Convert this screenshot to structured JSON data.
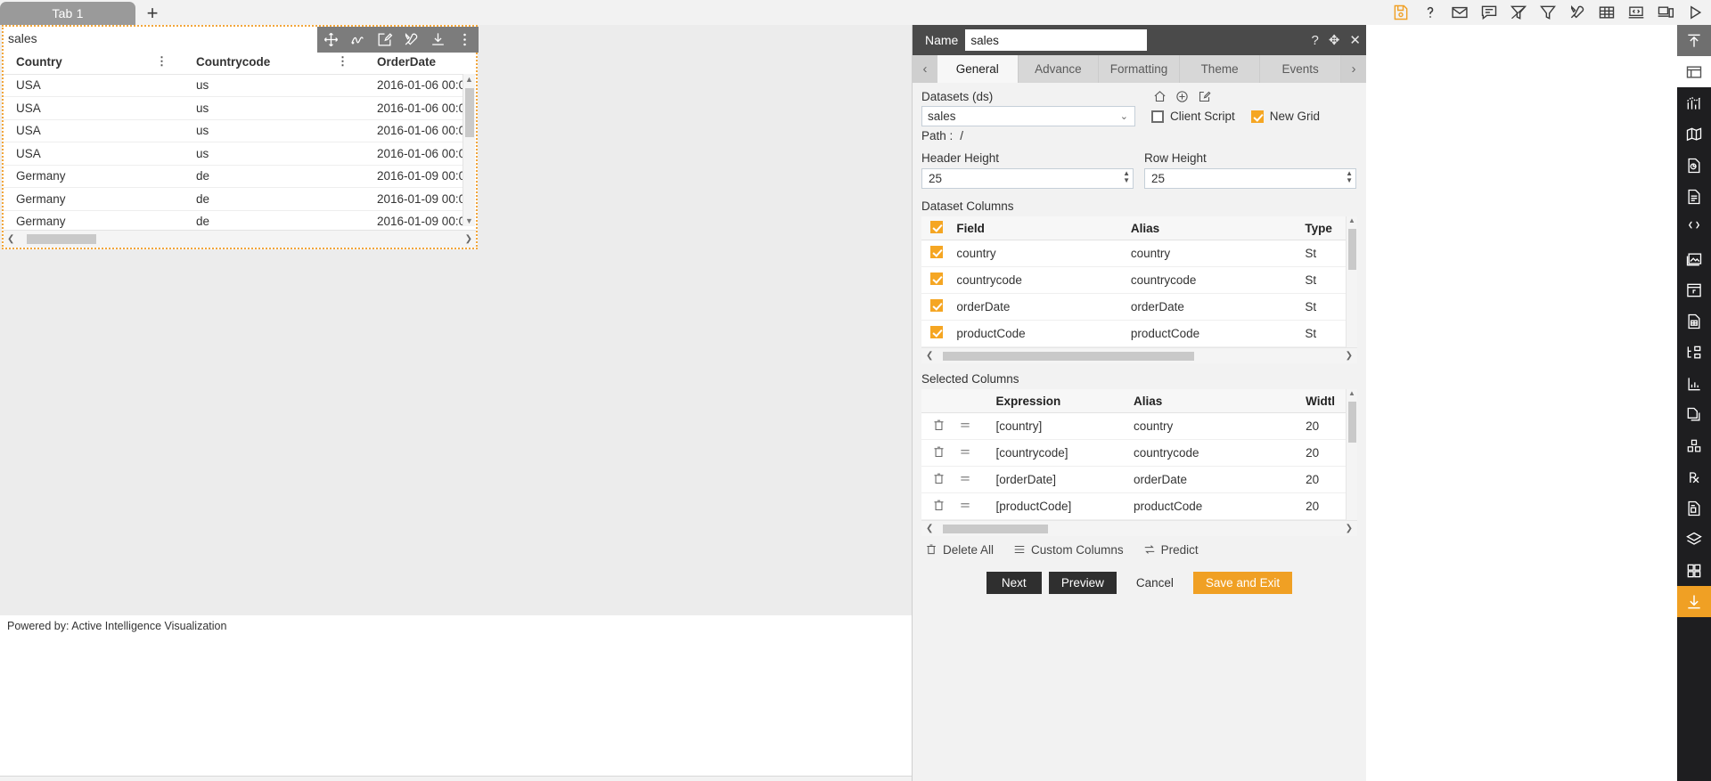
{
  "window": {
    "tabs": [
      {
        "label": "Tab 1"
      }
    ],
    "add_tab_label": "+",
    "system_toolbar": [
      {
        "name": "save-icon",
        "title": "Save"
      },
      {
        "name": "help-icon",
        "title": "Help"
      },
      {
        "name": "mail-icon",
        "title": "Mail"
      },
      {
        "name": "comment-icon",
        "title": "Comment"
      },
      {
        "name": "clear-filter-icon",
        "title": "Clear Filter"
      },
      {
        "name": "filter-icon",
        "title": "Filter"
      },
      {
        "name": "tools-icon",
        "title": "Tools"
      },
      {
        "name": "table-icon",
        "title": "Table"
      },
      {
        "name": "code-icon",
        "title": "Code"
      },
      {
        "name": "devices-icon",
        "title": "Devices"
      },
      {
        "name": "run-icon",
        "title": "Run"
      }
    ]
  },
  "widget": {
    "title": "sales",
    "toolbar": [
      {
        "name": "move-icon",
        "title": "Move"
      },
      {
        "name": "scribble-icon",
        "title": "Scribble"
      },
      {
        "name": "edit-icon",
        "title": "Edit"
      },
      {
        "name": "tools-icon",
        "title": "Tools"
      },
      {
        "name": "download-icon",
        "title": "Download"
      },
      {
        "name": "more-icon",
        "title": "More"
      }
    ],
    "columns": [
      "Country",
      "Countrycode",
      "OrderDate"
    ],
    "rows": [
      [
        "USA",
        "us",
        "2016-01-06 00:0"
      ],
      [
        "USA",
        "us",
        "2016-01-06 00:0"
      ],
      [
        "USA",
        "us",
        "2016-01-06 00:0"
      ],
      [
        "USA",
        "us",
        "2016-01-06 00:0"
      ],
      [
        "Germany",
        "de",
        "2016-01-09 00:0"
      ],
      [
        "Germany",
        "de",
        "2016-01-09 00:0"
      ],
      [
        "Germany",
        "de",
        "2016-01-09 00:0"
      ]
    ]
  },
  "footer": {
    "powered_by": "Powered by: Active Intelligence Visualization"
  },
  "properties": {
    "name_label": "Name",
    "name_value": "sales",
    "header_icons": [
      {
        "name": "help-icon",
        "glyph": "?"
      },
      {
        "name": "move-icon",
        "glyph": "✥"
      },
      {
        "name": "close-icon",
        "glyph": "✕"
      }
    ],
    "tabs": [
      {
        "label": "General",
        "active": true
      },
      {
        "label": "Advance",
        "active": false
      },
      {
        "label": "Formatting",
        "active": false
      },
      {
        "label": "Theme",
        "active": false
      },
      {
        "label": "Events",
        "active": false
      }
    ],
    "tab_prev": "‹",
    "tab_next": "›",
    "datasets": {
      "label": "Datasets (ds)",
      "selected": "sales",
      "icons": [
        {
          "name": "home-icon"
        },
        {
          "name": "add-icon"
        },
        {
          "name": "edit-icon"
        }
      ]
    },
    "client_script": {
      "label": "Client Script",
      "checked": false
    },
    "new_grid": {
      "label": "New Grid",
      "checked": true
    },
    "path": {
      "label": "Path :",
      "value": "/"
    },
    "header_height": {
      "label": "Header Height",
      "value": "25"
    },
    "row_height": {
      "label": "Row Height",
      "value": "25"
    },
    "dataset_columns": {
      "title": "Dataset Columns",
      "headers": [
        "Field",
        "Alias",
        "Type"
      ],
      "rows": [
        {
          "checked": true,
          "field": "country",
          "alias": "country",
          "type": "St"
        },
        {
          "checked": true,
          "field": "countrycode",
          "alias": "countrycode",
          "type": "St"
        },
        {
          "checked": true,
          "field": "orderDate",
          "alias": "orderDate",
          "type": "St"
        },
        {
          "checked": true,
          "field": "productCode",
          "alias": "productCode",
          "type": "St"
        }
      ],
      "header_checked": true
    },
    "selected_columns": {
      "title": "Selected Columns",
      "headers": [
        "Expression",
        "Alias",
        "Widtl"
      ],
      "rows": [
        {
          "expression": "[country]",
          "alias": "country",
          "width": "20"
        },
        {
          "expression": "[countrycode]",
          "alias": "countrycode",
          "width": "20"
        },
        {
          "expression": "[orderDate]",
          "alias": "orderDate",
          "width": "20"
        },
        {
          "expression": "[productCode]",
          "alias": "productCode",
          "width": "20"
        }
      ]
    },
    "actions": [
      {
        "name": "delete-all",
        "label": "Delete All",
        "icon": "trash-icon"
      },
      {
        "name": "custom-columns",
        "label": "Custom Columns",
        "icon": "list-icon"
      },
      {
        "name": "predict",
        "label": "Predict",
        "icon": "swap-icon"
      }
    ],
    "buttons": [
      {
        "name": "next-button",
        "label": "Next",
        "style": "dark"
      },
      {
        "name": "preview-button",
        "label": "Preview",
        "style": "dark"
      },
      {
        "name": "cancel-button",
        "label": "Cancel",
        "style": "plain"
      },
      {
        "name": "save-and-exit-button",
        "label": "Save and Exit",
        "style": "accent"
      }
    ]
  },
  "dock": [
    {
      "name": "collapse-icon",
      "state": "selected-dark"
    },
    {
      "name": "panel-icon",
      "state": "selected-light"
    },
    {
      "name": "chart-icon",
      "state": "normal"
    },
    {
      "name": "map-icon",
      "state": "normal"
    },
    {
      "name": "report-icon",
      "state": "normal"
    },
    {
      "name": "document-icon",
      "state": "normal"
    },
    {
      "name": "json-icon",
      "state": "normal"
    },
    {
      "name": "image-icon",
      "state": "normal"
    },
    {
      "name": "widget-icon",
      "state": "normal"
    },
    {
      "name": "datasheet-icon",
      "state": "normal"
    },
    {
      "name": "tree-icon",
      "state": "normal"
    },
    {
      "name": "analytics-icon",
      "state": "normal"
    },
    {
      "name": "copy-icon",
      "state": "normal"
    },
    {
      "name": "cubes-icon",
      "state": "normal"
    },
    {
      "name": "rx-icon",
      "state": "normal"
    },
    {
      "name": "script-icon",
      "state": "normal"
    },
    {
      "name": "layers-icon",
      "state": "normal"
    },
    {
      "name": "grid-icon",
      "state": "normal"
    },
    {
      "name": "download-icon",
      "state": "accent"
    }
  ],
  "colors": {
    "accent": "#f0a024",
    "selection_border": "#f2a63b",
    "panel_header": "#4a4a4a",
    "dock_bg": "#1e1e20"
  }
}
